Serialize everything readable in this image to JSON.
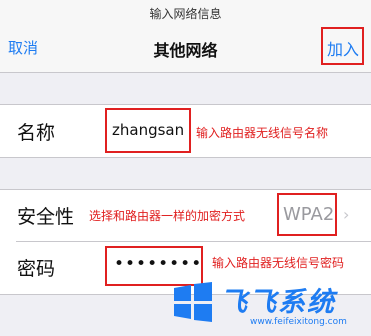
{
  "header": {
    "prompt": "输入网络信息",
    "title": "其他网络",
    "cancel_label": "取消",
    "join_label": "加入"
  },
  "form": {
    "name_label": "名称",
    "name_value": "zhangsan",
    "security_label": "安全性",
    "security_value": "WPA2",
    "password_label": "密码",
    "password_value": "••••••••"
  },
  "annotations": {
    "name_note": "输入路由器无线信号名称",
    "security_note": "选择和路由器一样的加密方式",
    "password_note": "输入路由器无线信号密码"
  },
  "watermark": {
    "brand": "飞飞系统",
    "url": "www.feifeixitong.com"
  },
  "colors": {
    "accent": "#1e7cf2",
    "annotation": "#e02020",
    "background": "#efeff4"
  },
  "icons": {
    "disclosure": "chevron-right-icon",
    "logo": "windows-logo-icon"
  }
}
